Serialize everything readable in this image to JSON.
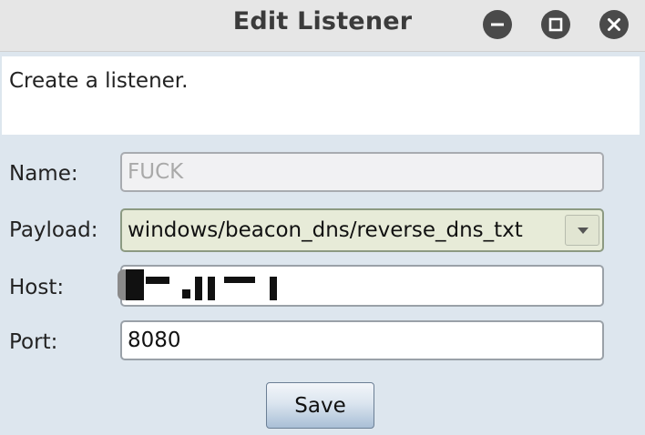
{
  "window": {
    "title": "Edit Listener"
  },
  "description": "Create a listener.",
  "form": {
    "name_label": "Name:",
    "name_value": "FUCK",
    "payload_label": "Payload:",
    "payload_value": "windows/beacon_dns/reverse_dns_txt",
    "host_label": "Host:",
    "host_value": "",
    "port_label": "Port:",
    "port_value": "8080"
  },
  "buttons": {
    "save_label": "Save"
  }
}
